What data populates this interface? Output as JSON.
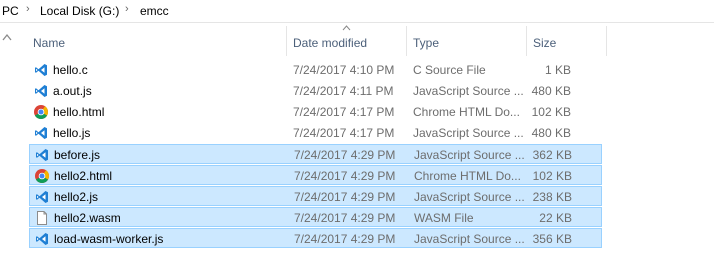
{
  "breadcrumb": {
    "items": [
      "PC",
      "Local Disk (G:)",
      "emcc"
    ],
    "separator": "›"
  },
  "columns": {
    "name": "Name",
    "date": "Date modified",
    "type": "Type",
    "size": "Size"
  },
  "files": [
    {
      "name": "hello.c",
      "date": "7/24/2017 4:10 PM",
      "type": "C Source File",
      "size": "1 KB",
      "icon": "vscode-icon",
      "selected": false
    },
    {
      "name": "a.out.js",
      "date": "7/24/2017 4:11 PM",
      "type": "JavaScript Source ...",
      "size": "480 KB",
      "icon": "vscode-icon",
      "selected": false
    },
    {
      "name": "hello.html",
      "date": "7/24/2017 4:17 PM",
      "type": "Chrome HTML Do...",
      "size": "102 KB",
      "icon": "chrome-icon",
      "selected": false
    },
    {
      "name": "hello.js",
      "date": "7/24/2017 4:17 PM",
      "type": "JavaScript Source ...",
      "size": "480 KB",
      "icon": "vscode-icon",
      "selected": false
    },
    {
      "name": "before.js",
      "date": "7/24/2017 4:29 PM",
      "type": "JavaScript Source ...",
      "size": "362 KB",
      "icon": "vscode-icon",
      "selected": true
    },
    {
      "name": "hello2.html",
      "date": "7/24/2017 4:29 PM",
      "type": "Chrome HTML Do...",
      "size": "102 KB",
      "icon": "chrome-icon",
      "selected": true
    },
    {
      "name": "hello2.js",
      "date": "7/24/2017 4:29 PM",
      "type": "JavaScript Source ...",
      "size": "238 KB",
      "icon": "vscode-icon",
      "selected": true
    },
    {
      "name": "hello2.wasm",
      "date": "7/24/2017 4:29 PM",
      "type": "WASM File",
      "size": "22 KB",
      "icon": "blank-file-icon",
      "selected": true
    },
    {
      "name": "load-wasm-worker.js",
      "date": "7/24/2017 4:29 PM",
      "type": "JavaScript Source ...",
      "size": "356 KB",
      "icon": "vscode-icon",
      "selected": true
    }
  ],
  "colors": {
    "selection_bg": "#cce8ff",
    "selection_border": "#99d1ff",
    "header_text": "#4c607a"
  }
}
